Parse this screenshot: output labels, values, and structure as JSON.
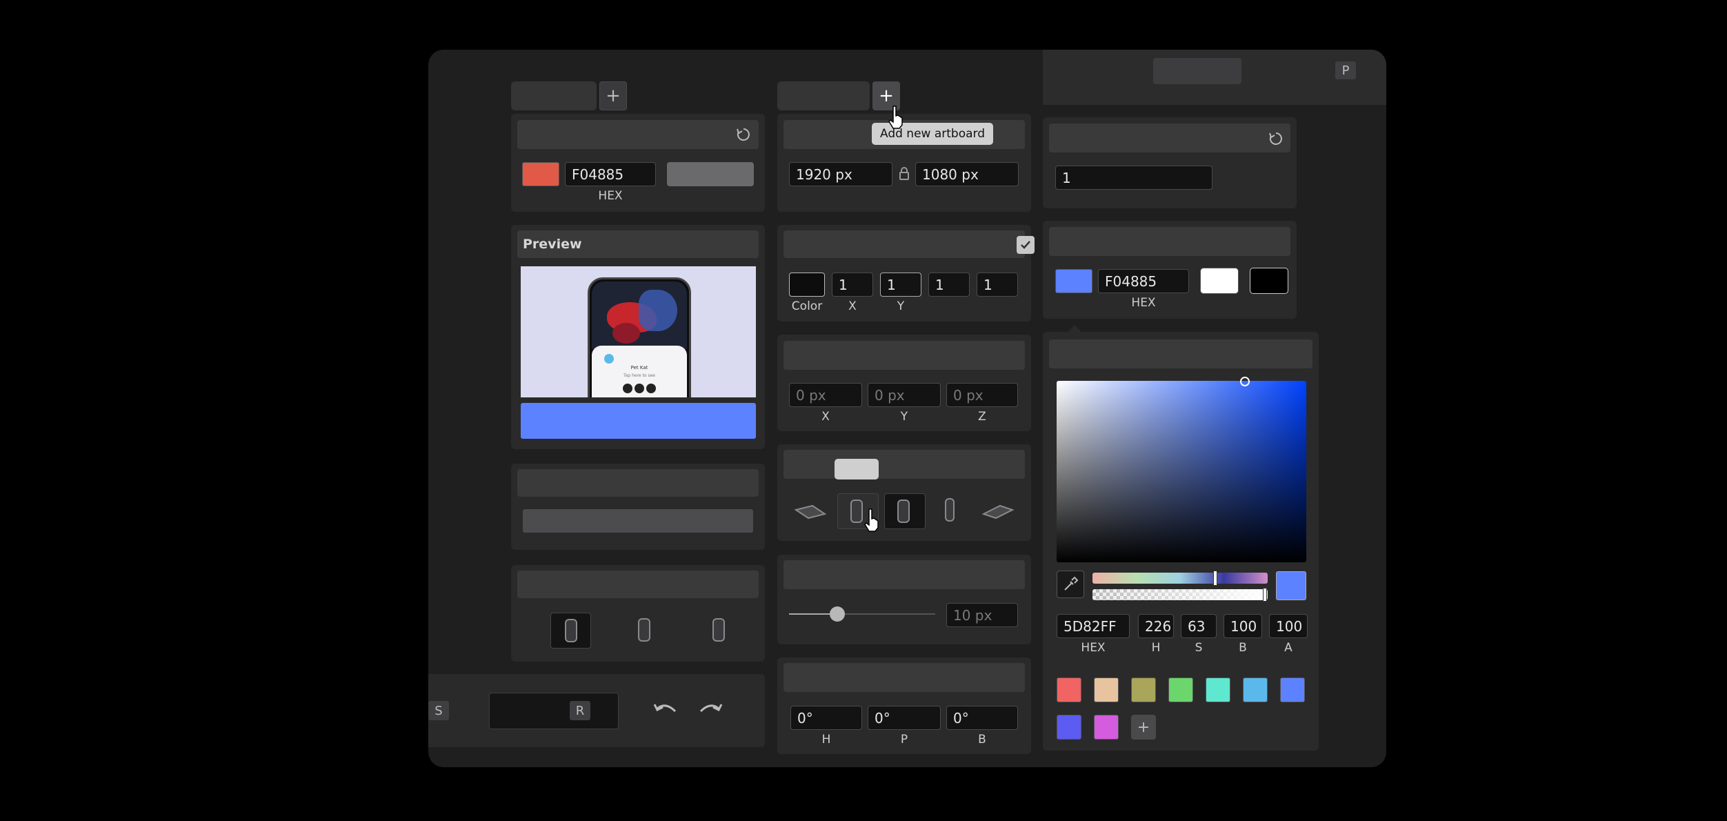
{
  "colors": {
    "accent": "#5D82FF",
    "primary_swatch": "#E05A47",
    "picker_swatch": "#5D82FF"
  },
  "background_panel": {
    "hex_value": "F04885",
    "hex_label": "HEX"
  },
  "preview_panel": {
    "title": "Preview",
    "phone_ui": {
      "app_name": "Pet Kat",
      "caption": "Tap here to see"
    }
  },
  "artboard_panel": {
    "add_tooltip": "Add new artboard",
    "width": "1920 px",
    "height": "1080 px"
  },
  "shadow_panel": {
    "values": [
      "1",
      "1",
      "1",
      "1"
    ],
    "labels": [
      "Color",
      "X",
      "Y"
    ]
  },
  "position_panel": {
    "values": [
      "0 px",
      "0 px",
      "0 px"
    ],
    "labels": [
      "X",
      "Y",
      "Z"
    ]
  },
  "corner_panel": {
    "value": "10 px",
    "slider_fraction": 0.33
  },
  "rotation_panel": {
    "values": [
      "0°",
      "0°",
      "0°"
    ],
    "labels": [
      "H",
      "P",
      "B"
    ]
  },
  "bottom_bar": {
    "shortcut_s": "S",
    "shortcut_r": "R"
  },
  "right_top": {
    "shortcut_p": "P"
  },
  "scale_panel": {
    "value": "1"
  },
  "material_panel": {
    "hex_value": "F04885",
    "hex_label": "HEX"
  },
  "color_picker": {
    "hex": "5D82FF",
    "h": "226",
    "s": "63",
    "b": "100",
    "a": "100",
    "labels": [
      "HEX",
      "H",
      "S",
      "B",
      "A"
    ],
    "hue_fraction": 0.7,
    "presets": [
      "#F26363",
      "#E8C3A0",
      "#A9A55A",
      "#6BD66B",
      "#5DE8CF",
      "#5BB8EA",
      "#5D82FF",
      "#5C5CF2",
      "#D45CDE"
    ]
  }
}
